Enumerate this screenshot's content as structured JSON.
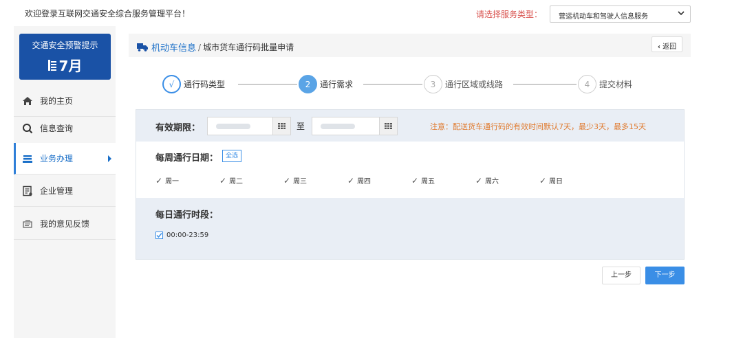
{
  "header": {
    "welcome": "欢迎登录互联网交通安全综合服务管理平台！",
    "service_label": "请选择服务类型：",
    "service_value": "营运机动车和驾驶人信息服务"
  },
  "sidebar": {
    "alert_title": "交通安全预警提示",
    "alert_month": "7月",
    "items": [
      {
        "label": "我的主页",
        "icon": "home-icon"
      },
      {
        "label": "信息查询",
        "icon": "search-icon"
      },
      {
        "label": "业务办理",
        "icon": "business-icon"
      },
      {
        "label": "企业管理",
        "icon": "enterprise-icon"
      },
      {
        "label": "我的意见反馈",
        "icon": "feedback-icon"
      }
    ]
  },
  "breadcrumb": {
    "section": "机动车信息",
    "separator": "/",
    "page": "城市货车通行码批量申请",
    "back_label": "返回"
  },
  "steps": [
    {
      "number": "√",
      "label": "通行码类型",
      "status": "done"
    },
    {
      "number": "2",
      "label": "通行需求",
      "status": "current"
    },
    {
      "number": "3",
      "label": "通行区域或线路",
      "status": "pending"
    },
    {
      "number": "4",
      "label": "提交材料",
      "status": "pending"
    }
  ],
  "form": {
    "validity_label": "有效期限：",
    "to_label": "至",
    "note": "注意：配送货车通行码的有效时间默认7天，最少3天，最多15天",
    "weekly_label": "每周通行日期：",
    "select_all": "全选",
    "days": [
      "周一",
      "周二",
      "周三",
      "周四",
      "周五",
      "周六",
      "周日"
    ],
    "daily_label": "每日通行时段：",
    "time_slot": "00:00-23:59"
  },
  "buttons": {
    "prev": "上一步",
    "next": "下一步"
  },
  "colors": {
    "primary": "#3a8ee6",
    "alert_bg": "#1a52a6",
    "note": "#e07a2e",
    "service_label": "#d9534f"
  }
}
